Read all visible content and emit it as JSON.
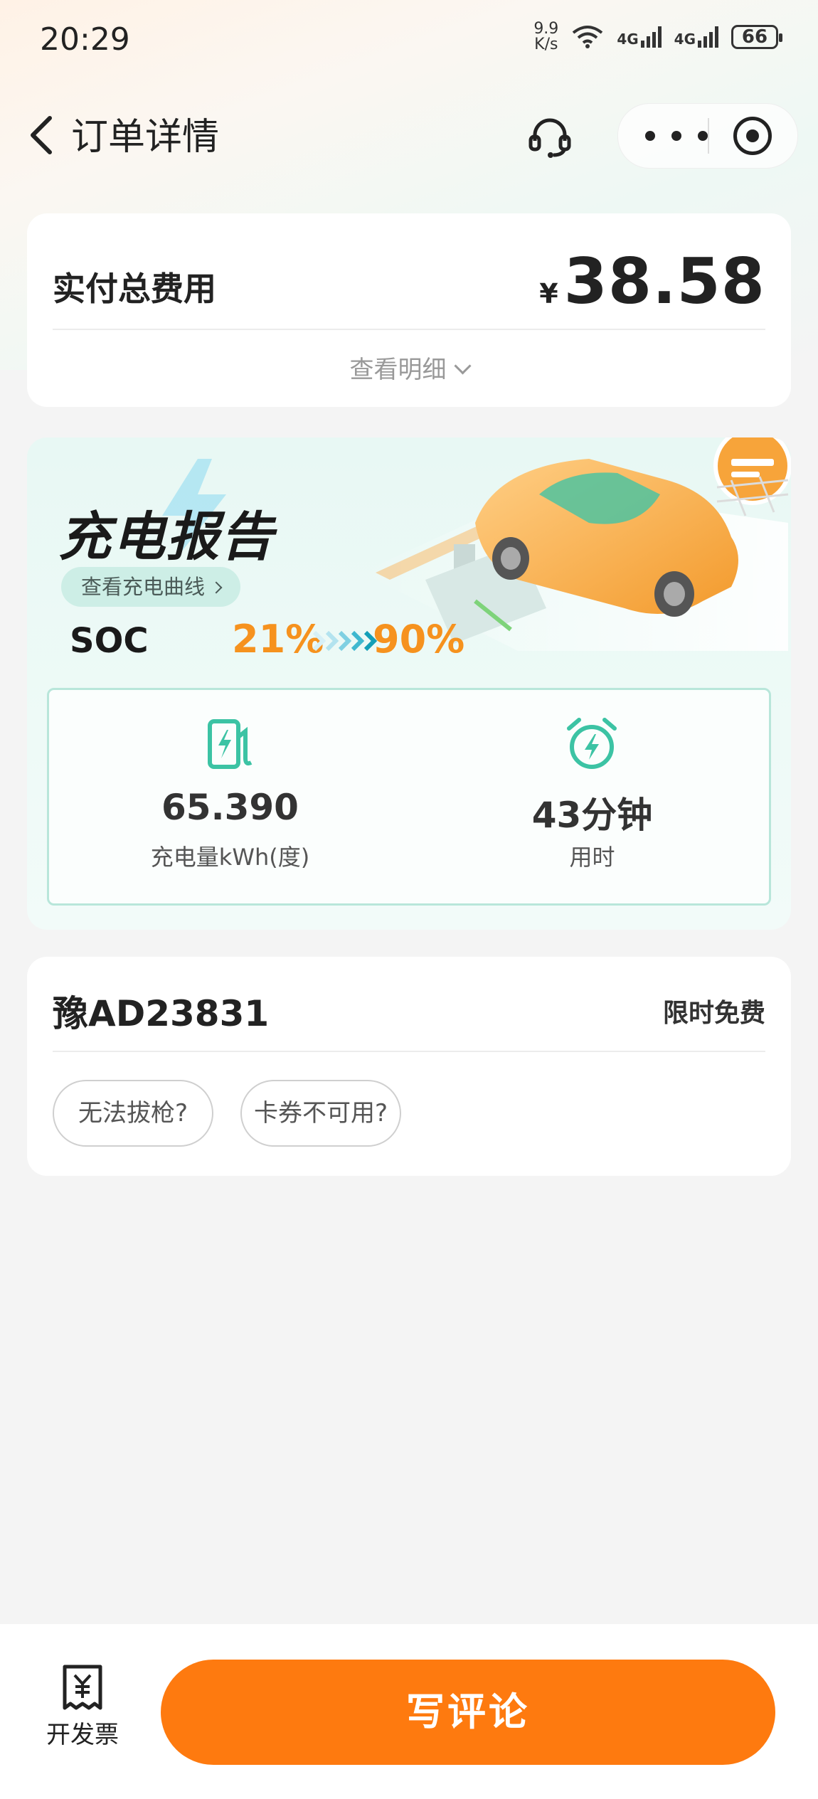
{
  "status_bar": {
    "time": "20:29",
    "net_speed_value": "9.9",
    "net_speed_unit": "K/s",
    "network_1": "4G",
    "network_2": "4G",
    "battery": "66"
  },
  "nav": {
    "title": "订单详情",
    "icons": [
      "back-icon",
      "headset-icon",
      "more-icon",
      "target-icon"
    ]
  },
  "fee": {
    "label": "实付总费用",
    "currency": "¥",
    "amount": "38.58",
    "detail_link": "查看明细"
  },
  "report": {
    "title": "充电报告",
    "curve_link": "查看充电曲线",
    "soc_label": "SOC",
    "soc_from": "21%",
    "soc_to": "90%",
    "stats": [
      {
        "icon": "charger-icon",
        "value": "65.390",
        "label": "充电量kWh(度)"
      },
      {
        "icon": "alarm-clock-icon",
        "value": "43分钟",
        "label": "用时"
      }
    ],
    "colors": {
      "accent": "#f6921e",
      "teal": "#3cc3a4"
    }
  },
  "vehicle": {
    "plate": "豫AD23831",
    "tag": "限时免费",
    "questions": [
      "无法拔枪?",
      "卡券不可用?"
    ]
  },
  "bottom": {
    "invoice_label": "开发票",
    "review_button": "写评论",
    "button_color": "#fe7a0f"
  }
}
